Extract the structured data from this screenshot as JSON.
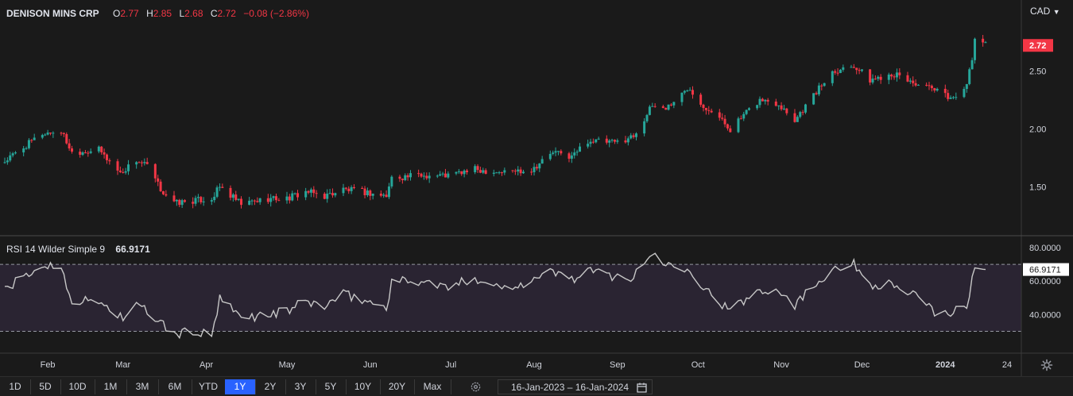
{
  "legend": {
    "symbol": "DENISON MINS CRP",
    "o_label": "O",
    "o_value": "2.77",
    "h_label": "H",
    "h_value": "2.85",
    "l_label": "L",
    "l_value": "2.68",
    "c_label": "C",
    "c_value": "2.72",
    "change": "−0.08 (−2.86%)"
  },
  "currency": "CAD",
  "last_price_label": "2.72",
  "rsi": {
    "label": "RSI 14 Wilder Simple 9",
    "value": "66.9171"
  },
  "ranges": [
    "1D",
    "5D",
    "10D",
    "1M",
    "3M",
    "6M",
    "YTD",
    "1Y",
    "2Y",
    "3Y",
    "5Y",
    "10Y",
    "20Y",
    "Max"
  ],
  "active_range": "1Y",
  "date_range": "16-Jan-2023  –  16-Jan-2024",
  "colors": {
    "up": "#26a69a",
    "down": "#f23645",
    "rsi_line": "#c7c7c7",
    "rsi_band": "#2a2432",
    "active": "#2962ff"
  },
  "chart_data": [
    {
      "type": "candlestick",
      "title": "DENISON MINS CRP",
      "currency": "CAD",
      "y_ticks": [
        1.5,
        2.0,
        2.5
      ],
      "ylim": [
        1.1,
        2.92
      ],
      "x_ticks": [
        "Feb",
        "Mar",
        "Apr",
        "May",
        "Jun",
        "Jul",
        "Aug",
        "Sep",
        "Oct",
        "Nov",
        "Dec",
        "2024",
        "24"
      ],
      "last_price": 2.72,
      "anchors": [
        [
          "2023-01-16",
          1.72
        ],
        [
          "2023-01-30",
          1.96
        ],
        [
          "2023-02-06",
          1.98
        ],
        [
          "2023-02-10",
          1.8
        ],
        [
          "2023-02-20",
          1.82
        ],
        [
          "2023-02-28",
          1.62
        ],
        [
          "2023-03-06",
          1.73
        ],
        [
          "2023-03-10",
          1.68
        ],
        [
          "2023-03-15",
          1.48
        ],
        [
          "2023-03-20",
          1.36
        ],
        [
          "2023-03-27",
          1.38
        ],
        [
          "2023-04-03",
          1.4
        ],
        [
          "2023-04-06",
          1.5
        ],
        [
          "2023-04-14",
          1.35
        ],
        [
          "2023-04-24",
          1.4
        ],
        [
          "2023-05-01",
          1.4
        ],
        [
          "2023-05-08",
          1.46
        ],
        [
          "2023-05-15",
          1.42
        ],
        [
          "2023-05-22",
          1.48
        ],
        [
          "2023-05-31",
          1.45
        ],
        [
          "2023-06-07",
          1.42
        ],
        [
          "2023-06-09",
          1.58
        ],
        [
          "2023-06-20",
          1.6
        ],
        [
          "2023-06-30",
          1.6
        ],
        [
          "2023-07-10",
          1.65
        ],
        [
          "2023-07-20",
          1.63
        ],
        [
          "2023-07-31",
          1.65
        ],
        [
          "2023-08-08",
          1.8
        ],
        [
          "2023-08-15",
          1.76
        ],
        [
          "2023-08-21",
          1.9
        ],
        [
          "2023-08-31",
          1.88
        ],
        [
          "2023-09-07",
          1.94
        ],
        [
          "2023-09-14",
          2.2
        ],
        [
          "2023-09-19",
          2.18
        ],
        [
          "2023-09-28",
          2.36
        ],
        [
          "2023-10-02",
          2.22
        ],
        [
          "2023-10-06",
          2.16
        ],
        [
          "2023-10-13",
          2.0
        ],
        [
          "2023-10-24",
          2.25
        ],
        [
          "2023-10-31",
          2.22
        ],
        [
          "2023-11-06",
          2.08
        ],
        [
          "2023-11-20",
          2.5
        ],
        [
          "2023-11-28",
          2.55
        ],
        [
          "2023-12-04",
          2.42
        ],
        [
          "2023-12-12",
          2.48
        ],
        [
          "2023-12-20",
          2.4
        ],
        [
          "2023-12-29",
          2.32
        ],
        [
          "2024-01-04",
          2.26
        ],
        [
          "2024-01-09",
          2.4
        ],
        [
          "2024-01-11",
          2.58
        ],
        [
          "2024-01-12",
          2.78
        ],
        [
          "2024-01-15",
          2.76
        ],
        [
          "2024-01-16",
          2.72
        ]
      ],
      "date_range": [
        "2023-01-16",
        "2024-01-16"
      ]
    },
    {
      "type": "line",
      "title": "RSI 14 Wilder Simple 9",
      "y_ticks": [
        40,
        60,
        80
      ],
      "bands": [
        30,
        70
      ],
      "last_value": 66.9171,
      "anchors": [
        [
          "2023-01-16",
          55
        ],
        [
          "2023-01-30",
          69
        ],
        [
          "2023-02-06",
          69
        ],
        [
          "2023-02-10",
          48
        ],
        [
          "2023-02-20",
          48
        ],
        [
          "2023-03-01",
          38
        ],
        [
          "2023-03-06",
          45
        ],
        [
          "2023-03-10",
          42
        ],
        [
          "2023-03-15",
          35
        ],
        [
          "2023-03-20",
          28
        ],
        [
          "2023-03-27",
          30
        ],
        [
          "2023-04-03",
          27
        ],
        [
          "2023-04-06",
          49
        ],
        [
          "2023-04-14",
          38
        ],
        [
          "2023-04-24",
          40
        ],
        [
          "2023-05-01",
          42
        ],
        [
          "2023-05-08",
          48
        ],
        [
          "2023-05-15",
          45
        ],
        [
          "2023-05-22",
          52
        ],
        [
          "2023-05-31",
          48
        ],
        [
          "2023-06-07",
          44
        ],
        [
          "2023-06-09",
          60
        ],
        [
          "2023-06-20",
          60
        ],
        [
          "2023-06-30",
          56
        ],
        [
          "2023-07-10",
          62
        ],
        [
          "2023-07-20",
          56
        ],
        [
          "2023-07-31",
          60
        ],
        [
          "2023-08-08",
          66
        ],
        [
          "2023-08-15",
          61
        ],
        [
          "2023-08-21",
          66
        ],
        [
          "2023-08-31",
          63
        ],
        [
          "2023-09-07",
          62
        ],
        [
          "2023-09-14",
          77
        ],
        [
          "2023-09-19",
          70
        ],
        [
          "2023-09-28",
          68
        ],
        [
          "2023-10-02",
          58
        ],
        [
          "2023-10-06",
          52
        ],
        [
          "2023-10-13",
          42
        ],
        [
          "2023-10-24",
          55
        ],
        [
          "2023-10-31",
          55
        ],
        [
          "2023-11-06",
          46
        ],
        [
          "2023-11-20",
          68
        ],
        [
          "2023-11-28",
          70
        ],
        [
          "2023-12-04",
          58
        ],
        [
          "2023-12-12",
          58
        ],
        [
          "2023-12-20",
          52
        ],
        [
          "2023-12-29",
          40
        ],
        [
          "2024-01-04",
          42
        ],
        [
          "2024-01-09",
          44
        ],
        [
          "2024-01-11",
          60
        ],
        [
          "2024-01-12",
          68
        ],
        [
          "2024-01-15",
          70
        ],
        [
          "2024-01-16",
          66.9
        ]
      ]
    }
  ]
}
